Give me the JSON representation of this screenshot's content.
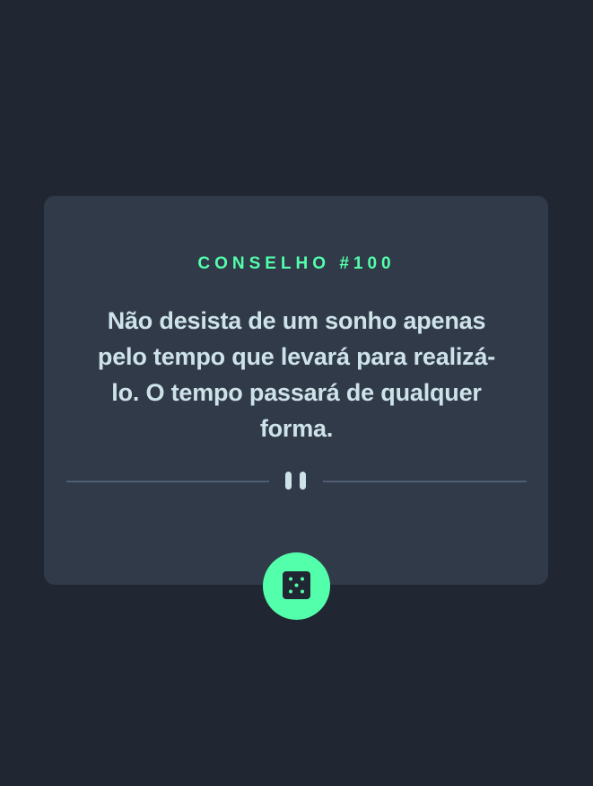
{
  "advice": {
    "id_label": "CONSELHO #100",
    "text": "Não desista de um sonho apenas pelo tempo que levará para realizá-lo. O tempo passará de qualquer forma."
  },
  "icons": {
    "divider": "pause-icon",
    "button": "dice-icon"
  },
  "colors": {
    "background": "#202632",
    "card": "#313a49",
    "accent": "#53ffab",
    "text": "#cee3e9",
    "divider": "#4e5d73"
  }
}
